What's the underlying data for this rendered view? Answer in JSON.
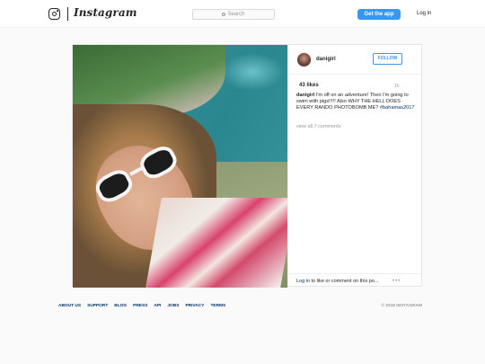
{
  "header": {
    "wordmark": "Instagram",
    "search_placeholder": "Search",
    "get_app": "Get the app",
    "login": "Log in",
    "icons": [
      "instagram-camera-icon",
      "search-icon"
    ]
  },
  "post": {
    "username": "danigirl",
    "follow_label": "FOLLOW",
    "likes": "43 likes",
    "age": "1h",
    "caption_author": "danigirl",
    "caption_text": "I'm off on an adventure! Then I'm going to swim with pigs!!!!! Also WHY THE HELL DOES EVERY RANDO PHOTOBOMB ME?",
    "hashtag": "#bahamas2017",
    "view_all": "view all 7 comments",
    "login_link": "Log in",
    "login_prompt": " to like or comment on this po...",
    "more": "•••"
  },
  "footer": {
    "links": [
      "ABOUT US",
      "SUPPORT",
      "BLOG",
      "PRESS",
      "API",
      "JOBS",
      "PRIVACY",
      "TERMS"
    ],
    "copyright": "© 2016 INSTAGRAM"
  },
  "colors": {
    "accent": "#3897f0",
    "link": "#003569",
    "background": "#fafafa"
  }
}
